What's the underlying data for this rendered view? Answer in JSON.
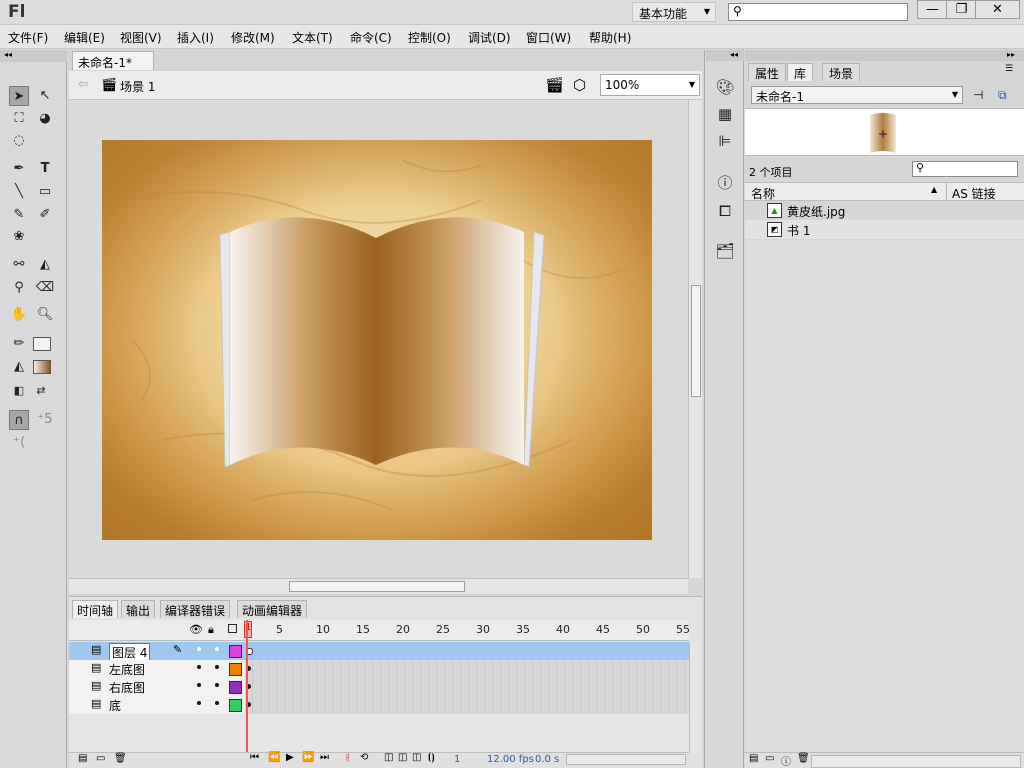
{
  "app": {
    "logo": "Fl",
    "workspace": "基本功能"
  },
  "window_buttons": [
    "—",
    "❐",
    "✕"
  ],
  "menu": [
    "文件(F)",
    "编辑(E)",
    "视图(V)",
    "插入(I)",
    "修改(M)",
    "文本(T)",
    "命令(C)",
    "控制(O)",
    "调试(D)",
    "窗口(W)",
    "帮助(H)"
  ],
  "document": {
    "tab_label": "未命名-1*",
    "tab_close": "×",
    "scene_label": "场景 1",
    "zoom": "100%"
  },
  "bottom_tabs": [
    "时间轴",
    "输出",
    "编译器错误",
    "动画编辑器"
  ],
  "timeline": {
    "frame_numbers": [
      "5",
      "10",
      "15",
      "20",
      "25",
      "30",
      "35",
      "40",
      "45",
      "50",
      "55"
    ],
    "current_frame_marker": "1",
    "layers": [
      {
        "name": "图层 4",
        "active": true,
        "color": "#e040e0"
      },
      {
        "name": "左底图",
        "active": false,
        "color": "#f08000"
      },
      {
        "name": "右底图",
        "active": false,
        "color": "#9030c0"
      },
      {
        "name": "底",
        "active": false,
        "color": "#30d060"
      }
    ],
    "footer": {
      "frame": "1",
      "fps": "12.00 fps",
      "time": "0.0 s"
    }
  },
  "right_tabs": [
    "属性",
    "库",
    "场景"
  ],
  "library": {
    "document_select": "未命名-1",
    "item_count": "2 个项目",
    "columns": {
      "name": "名称",
      "linkage": "AS 链接"
    },
    "items": [
      {
        "name": "黄皮纸.jpg",
        "icon": "bitmap-icon"
      },
      {
        "name": "书 1",
        "icon": "graphic-symbol-icon"
      }
    ]
  },
  "colors": {
    "stage_paper": "#eccf93",
    "book_brown": "#9c6420",
    "layer_highlight": "#9ec8ef",
    "playhead": "#e55555"
  }
}
